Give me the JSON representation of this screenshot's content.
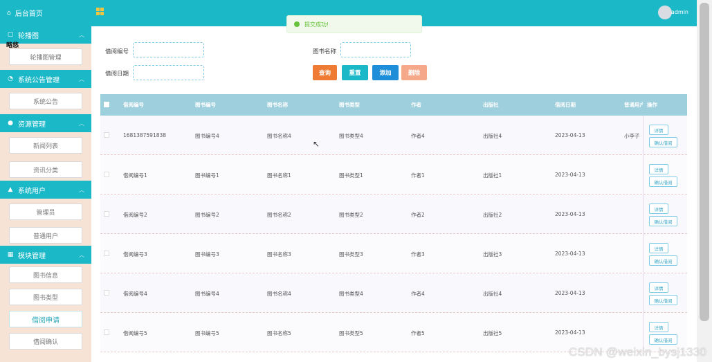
{
  "sidebar": {
    "home": "后台首页",
    "collapse_text": "略悠",
    "sections": [
      {
        "label": "轮播图",
        "items": [
          "轮播图管理"
        ]
      },
      {
        "label": "系统公告管理",
        "items": [
          "系统公告"
        ]
      },
      {
        "label": "资源管理",
        "items": [
          "新闻列表",
          "资讯分类"
        ]
      },
      {
        "label": "系统用户",
        "items": [
          "管理员",
          "普通用户"
        ]
      },
      {
        "label": "模块管理",
        "items": [
          "图书信息",
          "图书类型",
          "借阅申请",
          "借阅确认"
        ]
      }
    ]
  },
  "topbar": {
    "user": "admin"
  },
  "toast": {
    "text": "提交成功!"
  },
  "search": {
    "borrow_no_label": "借阅编号",
    "book_name_label": "图书名称",
    "borrow_date_label": "借阅日期",
    "borrow_no_value": "",
    "book_name_value": "",
    "borrow_date_value": ""
  },
  "buttons": {
    "query": "查询",
    "reset": "重置",
    "add": "添加",
    "delete": "删除"
  },
  "colors": {
    "query": "#ef7a33",
    "reset": "#1bb8c8",
    "add": "#1e8ed8",
    "delete": "#f5a98a",
    "theme": "#1bb8c8"
  },
  "table": {
    "headers": [
      "借阅编号",
      "图书编号",
      "图书名称",
      "图书类型",
      "作者",
      "出版社",
      "借阅日期",
      "普通用户",
      "操作"
    ],
    "rows": [
      [
        "1681387591838",
        "图书编号4",
        "图书名称4",
        "图书类型4",
        "作者4",
        "出版社4",
        "2023-04-13",
        "小李子"
      ],
      [
        "借阅编号1",
        "图书编号1",
        "图书名称1",
        "图书类型1",
        "作者1",
        "出版社1",
        "2023-04-13",
        ""
      ],
      [
        "借阅编号2",
        "图书编号2",
        "图书名称2",
        "图书类型2",
        "作者2",
        "出版社2",
        "2023-04-13",
        ""
      ],
      [
        "借阅编号3",
        "图书编号3",
        "图书名称3",
        "图书类型3",
        "作者3",
        "出版社3",
        "2023-04-13",
        ""
      ],
      [
        "借阅编号4",
        "图书编号4",
        "图书名称4",
        "图书类型4",
        "作者4",
        "出版社4",
        "2023-04-13",
        ""
      ],
      [
        "借阅编号5",
        "图书编号5",
        "图书名称5",
        "图书类型5",
        "作者5",
        "出版社5",
        "2023-04-13",
        ""
      ]
    ],
    "row_actions": [
      "详情",
      "确认借阅"
    ]
  },
  "watermark": "CSDN @weixin_bysj1330"
}
